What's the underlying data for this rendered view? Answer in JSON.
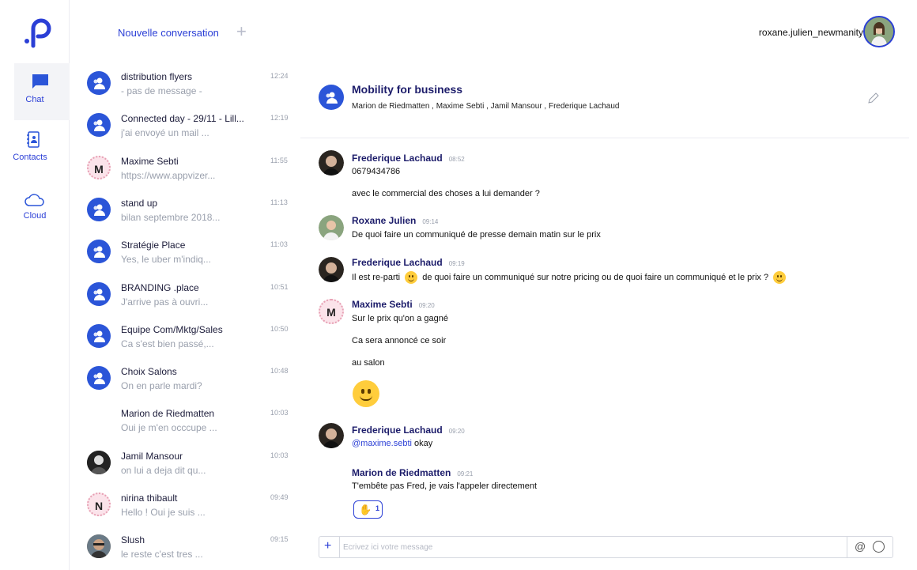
{
  "app": {
    "logo": "P"
  },
  "nav": [
    {
      "label": "Chat",
      "icon": "chat-bubble-icon",
      "active": true
    },
    {
      "label": "Contacts",
      "icon": "address-book-icon",
      "active": false
    },
    {
      "label": "Cloud",
      "icon": "cloud-icon",
      "active": false
    }
  ],
  "header": {
    "new_conversation": "Nouvelle conversation",
    "plus": "+",
    "username": "roxane.julien_newmanity"
  },
  "conversations": [
    {
      "name": "distribution flyers",
      "preview": "- pas de message -",
      "time": "12:24",
      "avatar": "group"
    },
    {
      "name": "Connected day - 29/11 - Lill...",
      "preview": "j'ai envoyé un mail ...",
      "time": "12:19",
      "avatar": "group"
    },
    {
      "name": "Maxime Sebti",
      "preview": "https://www.appvizer...",
      "time": "11:55",
      "avatar": "M"
    },
    {
      "name": "stand up",
      "preview": "bilan septembre 2018...",
      "time": "11:13",
      "avatar": "group"
    },
    {
      "name": "Stratégie Place",
      "preview": "Yes, le uber m'indiq...",
      "time": "11:03",
      "avatar": "group"
    },
    {
      "name": "BRANDING .place",
      "preview": "J'arrive pas à ouvri...",
      "time": "10:51",
      "avatar": "group"
    },
    {
      "name": "Equipe Com/Mktg/Sales",
      "preview": "Ca s'est bien passé,...",
      "time": "10:50",
      "avatar": "group"
    },
    {
      "name": "Choix Salons",
      "preview": "On en parle mardi?",
      "time": "10:48",
      "avatar": "group"
    },
    {
      "name": "Marion de Riedmatten",
      "preview": "Oui je m'en occcupe ...",
      "time": "10:03",
      "avatar": "none"
    },
    {
      "name": "Jamil Mansour",
      "preview": "on lui a deja dit qu...",
      "time": "10:03",
      "avatar": "dark"
    },
    {
      "name": "nirina thibault",
      "preview": "Hello ! Oui je suis ...",
      "time": "09:49",
      "avatar": "N"
    },
    {
      "name": "Slush",
      "preview": "le reste c'est tres ...",
      "time": "09:15",
      "avatar": "photo"
    }
  ],
  "room": {
    "title": "Mobility for business",
    "members": "Marion de Riedmatten , Maxime Sebti , Jamil Mansour , Frederique Lachaud"
  },
  "messages": {
    "m1": {
      "sender": "Frederique Lachaud",
      "time": "08:52",
      "lines": [
        "0679434786",
        "avec le commercial des choses a lui demander ?"
      ]
    },
    "m2": {
      "sender": "Roxane Julien",
      "time": "09:14",
      "lines": [
        "De quoi faire un communiqué de presse demain matin sur le prix"
      ]
    },
    "m3": {
      "sender": "Frederique Lachaud",
      "time": "09:19",
      "part1": "Il est re-parti",
      "part2": "de quoi faire un communiqué sur notre pricing ou de quoi faire un communiqué et le prix ?"
    },
    "m4": {
      "sender": "Maxime Sebti",
      "time": "09:20",
      "avatar": "M",
      "lines": [
        "Sur le prix qu'on a gagné",
        "Ca sera annoncé ce soir",
        "au salon"
      ]
    },
    "m5": {
      "sender": "Frederique Lachaud",
      "time": "09:20",
      "mention": "@maxime.sebti",
      "rest": " okay"
    },
    "m6": {
      "sender": "Marion de Riedmatten",
      "time": "09:21",
      "lines": [
        "T'embête pas Fred, je vais l'appeler directement"
      ],
      "reaction_count": "1"
    }
  },
  "composer": {
    "placeholder": "Ecrivez ici votre message",
    "at": "@"
  },
  "colors": {
    "accent": "#2b3fd6",
    "group_avatar": "#2b55d8"
  }
}
